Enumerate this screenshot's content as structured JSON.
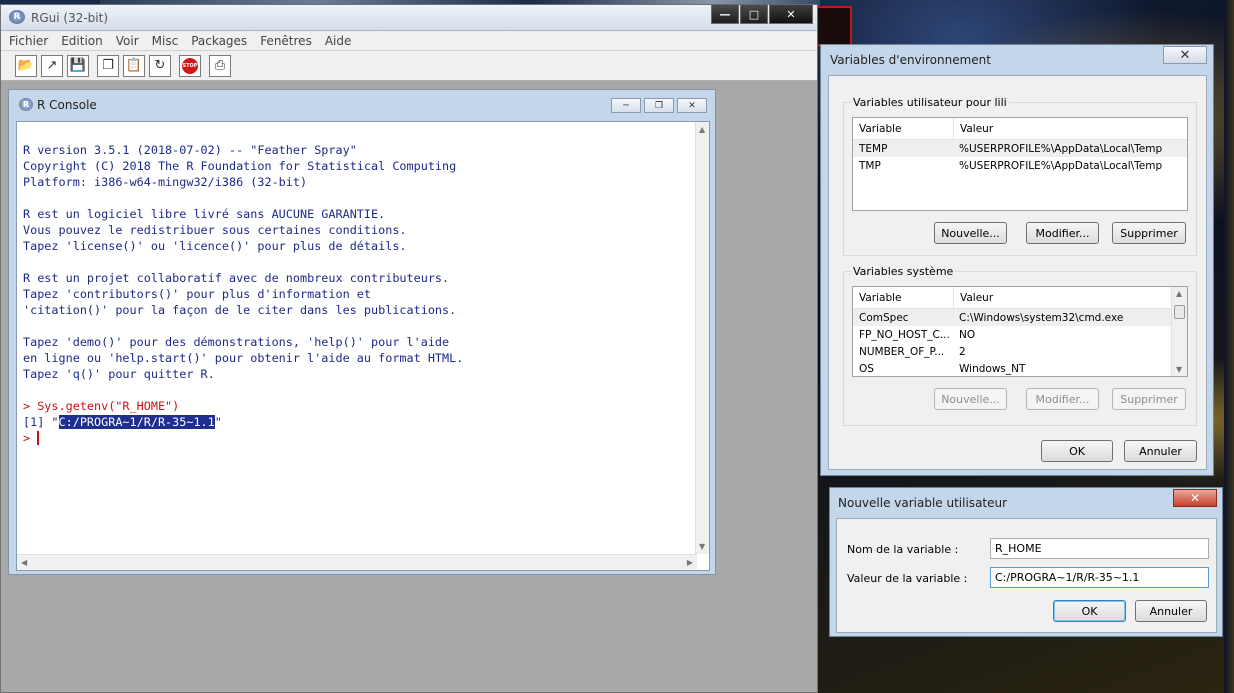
{
  "rgui": {
    "title": "RGui (32-bit)",
    "menu": [
      "Fichier",
      "Edition",
      "Voir",
      "Misc",
      "Packages",
      "Fenêtres",
      "Aide"
    ]
  },
  "console": {
    "title": "R Console",
    "lines": [
      "R version 3.5.1 (2018-07-02) -- \"Feather Spray\"",
      "Copyright (C) 2018 The R Foundation for Statistical Computing",
      "Platform: i386-w64-mingw32/i386 (32-bit)",
      "",
      "R est un logiciel libre livré sans AUCUNE GARANTIE.",
      "Vous pouvez le redistribuer sous certaines conditions.",
      "Tapez 'license()' ou 'licence()' pour plus de détails.",
      "",
      "R est un projet collaboratif avec de nombreux contributeurs.",
      "Tapez 'contributors()' pour plus d'information et",
      "'citation()' pour la façon de le citer dans les publications.",
      "",
      "Tapez 'demo()' pour des démonstrations, 'help()' pour l'aide",
      "en ligne ou 'help.start()' pour obtenir l'aide au format HTML.",
      "Tapez 'q()' pour quitter R.",
      ""
    ],
    "command": "> Sys.getenv(\"R_HOME\")",
    "output_prefix": "[1] \"",
    "output_selected": "C:/PROGRA~1/R/R-35~1.1",
    "output_suffix": "\"",
    "prompt": "> "
  },
  "env_dialog": {
    "title": "Variables d'environnement",
    "user_group_label": "Variables utilisateur pour lili",
    "col_variable": "Variable",
    "col_value": "Valeur",
    "user_vars": [
      {
        "name": "TEMP",
        "value": "%USERPROFILE%\\AppData\\Local\\Temp"
      },
      {
        "name": "TMP",
        "value": "%USERPROFILE%\\AppData\\Local\\Temp"
      }
    ],
    "user_buttons": {
      "new": "Nouvelle...",
      "edit": "Modifier...",
      "delete": "Supprimer"
    },
    "system_group_label": "Variables système",
    "system_vars": [
      {
        "name": "ComSpec",
        "value": "C:\\Windows\\system32\\cmd.exe"
      },
      {
        "name": "FP_NO_HOST_C...",
        "value": "NO"
      },
      {
        "name": "NUMBER_OF_P...",
        "value": "2"
      },
      {
        "name": "OS",
        "value": "Windows_NT"
      }
    ],
    "system_buttons": {
      "new": "Nouvelle...",
      "edit": "Modifier...",
      "delete": "Supprimer"
    },
    "ok": "OK",
    "cancel": "Annuler"
  },
  "new_var_dialog": {
    "title": "Nouvelle variable utilisateur",
    "name_label": "Nom de la variable :",
    "name_value": "R_HOME",
    "value_label": "Valeur de la variable :",
    "value_value": "C:/PROGRA~1/R/R-35~1.1",
    "ok": "OK",
    "cancel": "Annuler"
  }
}
